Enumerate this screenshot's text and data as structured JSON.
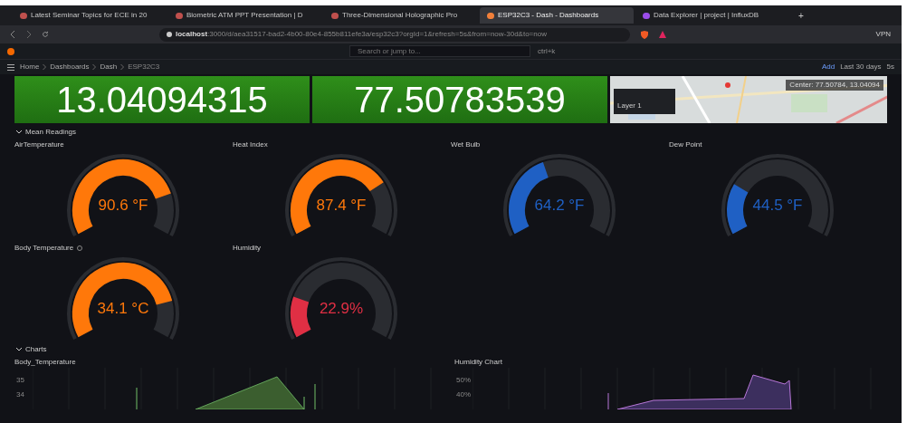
{
  "browser": {
    "tabs": [
      {
        "title": "Latest Seminar Topics for ECE in 20",
        "selected": false,
        "color": "#c0504d"
      },
      {
        "title": "Biometric ATM PPT Presentation | D",
        "selected": false,
        "color": "#c0504d"
      },
      {
        "title": "Three-Dimensional Holographic Pro",
        "selected": false,
        "color": "#c0504d"
      },
      {
        "title": "ESP32C3 - Dash - Dashboards",
        "selected": true,
        "color": "#f2803a"
      },
      {
        "title": "Data Explorer | project | InfluxDB",
        "selected": false,
        "color": "#9b4dea"
      }
    ],
    "new_tab": "+",
    "url_host": "localhost",
    "url_rest": ":3000/d/aea31517-bad2-4b00-80e4-855b811efe3a/esp32c3?orgId=1&refresh=5s&from=now-30d&to=now",
    "vpn": "VPN"
  },
  "grafana": {
    "search": {
      "placeholder": "Search or jump to...",
      "shortcut": "ctrl+k"
    },
    "breadcrumb": [
      "Home",
      "Dashboards",
      "Dash",
      "ESP32C3"
    ],
    "toolbar": {
      "add": "Add",
      "time_range": "Last 30 days",
      "refresh": "5s"
    }
  },
  "stats": [
    {
      "value": "13.04094315"
    },
    {
      "value": "77.50783539"
    }
  ],
  "map": {
    "layer": "Layer 1",
    "center": "Center: 77.50784, 13.04094"
  },
  "mean_readings": {
    "title": "Mean Readings",
    "gauges": [
      {
        "title": "AirTemperature",
        "value": "90.6 °F",
        "color": "#ff780a",
        "info": false
      },
      {
        "title": "Heat Index",
        "value": "87.4 °F",
        "color": "#ff780a",
        "info": false
      },
      {
        "title": "Wet Bulb",
        "value": "64.2 °F",
        "color": "#1f60c4",
        "info": false
      },
      {
        "title": "Dew Point",
        "value": "44.5 °F",
        "color": "#1f60c4",
        "info": false
      },
      {
        "title": "Body Temperature",
        "value": "34.1 °C",
        "color": "#ff780a",
        "info": true
      },
      {
        "title": "Humidity",
        "value": "22.9%",
        "color": "#e02f44",
        "info": false
      }
    ]
  },
  "charts": {
    "title": "Charts",
    "panels": [
      {
        "title": "Body_Temperature",
        "kind": "body",
        "ticks": [
          "35",
          "34"
        ]
      },
      {
        "title": "Humidity Chart",
        "kind": "humidity",
        "ticks": [
          "50%",
          "40%"
        ]
      }
    ]
  }
}
